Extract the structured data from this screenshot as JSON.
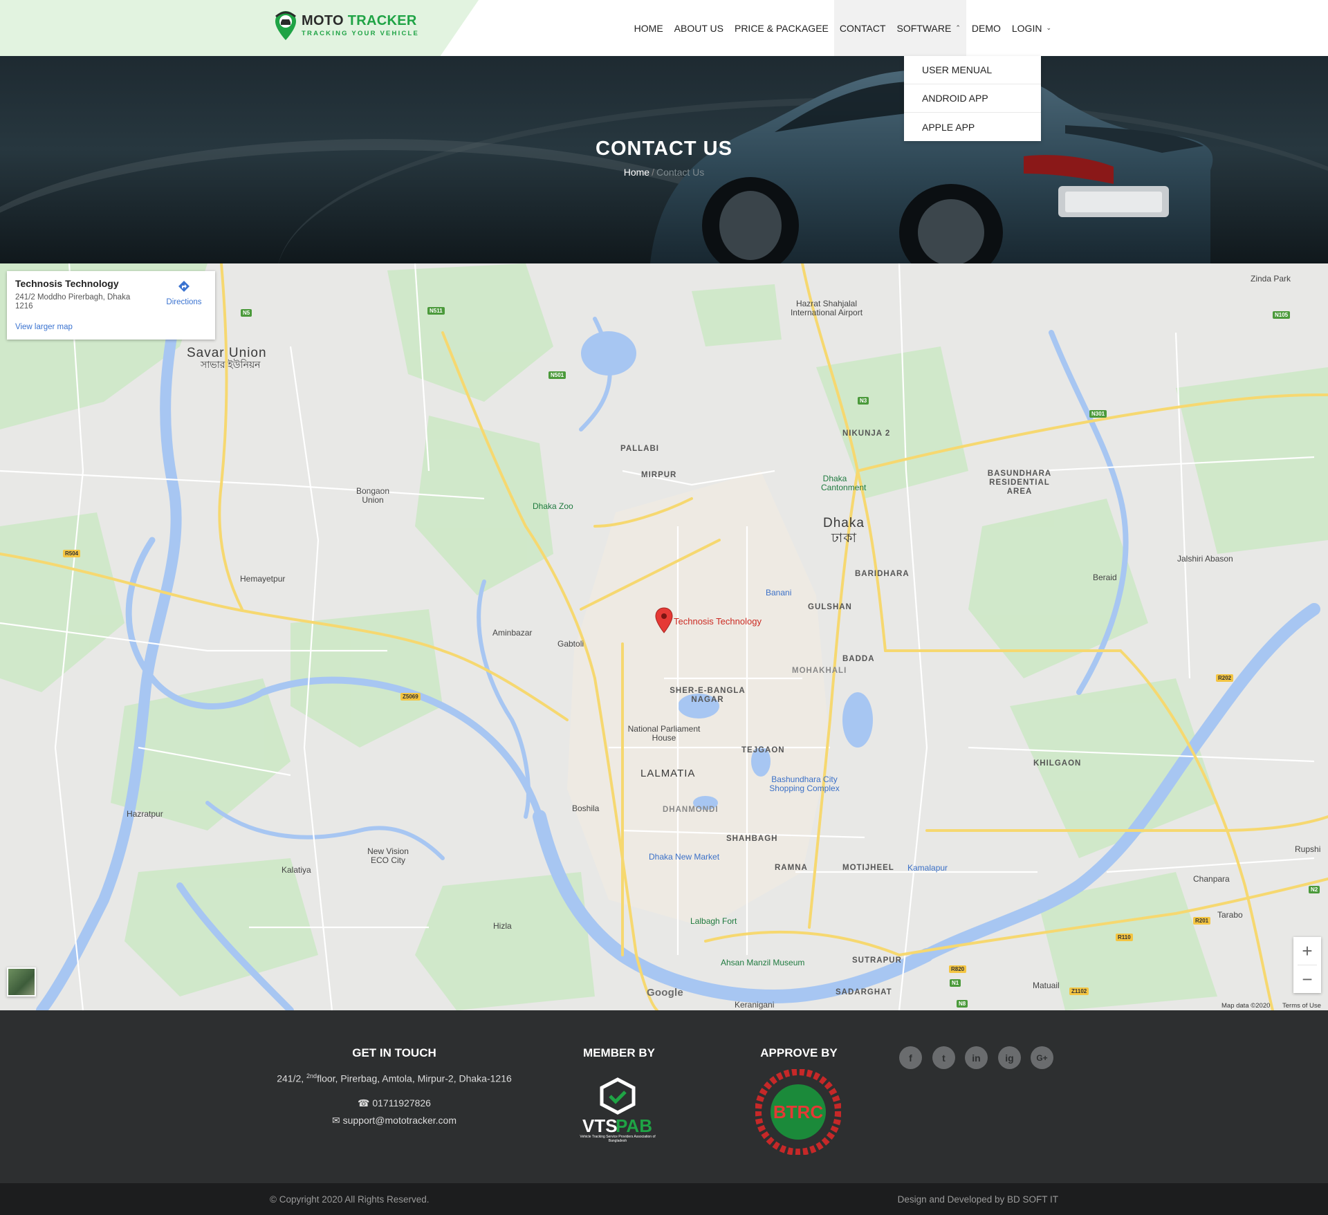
{
  "brand": {
    "name_part1": "MOTO",
    "name_part2": "TRACKER",
    "tagline": "TRACKING YOUR VEHICLE",
    "accent": "#1fa345"
  },
  "nav": {
    "items": [
      "HOME",
      "ABOUT US",
      "PRICE & PACKAGEE",
      "CONTACT",
      "SOFTWARE",
      "DEMO",
      "LOGIN"
    ],
    "software_menu": [
      "USER MENUAL",
      "ANDROID APP",
      "APPLE APP"
    ]
  },
  "hero": {
    "title": "CONTACT US",
    "crumb_home": "Home",
    "crumb_sep": "/",
    "crumb_current": "Contact Us"
  },
  "map": {
    "card_title": "Technosis Technology",
    "card_address": "241/2 Moddho Pirerbagh, Dhaka 1216",
    "directions": "Directions",
    "larger_map": "View larger map",
    "marker_label": "Technosis Technology",
    "google": "Google",
    "map_data": "Map data ©2020",
    "terms": "Terms of Use",
    "places": {
      "savar": "Savar Union",
      "savar_bn": "সাভার ইউনিয়ন",
      "hazrat": "Hazrat Shahjalal International Airport",
      "zinda": "Zinda Park",
      "pallabi": "PALLABI",
      "mirpur": "MIRPUR",
      "nikunja": "NIKUNJA 2",
      "basundhara": "BASUNDHARA RESIDENTIAL AREA",
      "bongaon": "Bongaon Union",
      "dhaka_zoo": "Dhaka Zoo",
      "dhaka_cant": "Dhaka Cantonment",
      "dhaka": "Dhaka",
      "dhaka_bn": "ঢাকা",
      "hemayetpur": "Hemayetpur",
      "baridhara": "BARIDHARA",
      "banani": "Banani",
      "jalshiri": "Jalshiri Abason",
      "beraid": "Beraid",
      "gulshan": "GULSHAN",
      "aminbazar": "Aminbazar",
      "gabtoli": "Gabtoli",
      "badda": "BADDA",
      "mohakhali": "MOHAKHALI",
      "sher": "SHER-E-BANGLA NAGAR",
      "parliament": "National Parliament House",
      "tejgaon": "TEJGAON",
      "lalmatia": "LALMATIA",
      "khilgaon": "KHILGAON",
      "bashundhara_city": "Bashundhara City Shopping Complex",
      "hazratpur": "Hazratpur",
      "boshila": "Boshila",
      "dhanmondi": "DHANMONDI",
      "new_vision": "New Vision ECO City",
      "shahbagh": "SHAHBAGH",
      "kalatiya": "Kalatiya",
      "dhaka_new_market": "Dhaka New Market",
      "ramna": "RAMNA",
      "motijheel": "MOTIJHEEL",
      "kamalapur": "Kamalapur",
      "chanpara": "Chanpara",
      "rupshi": "Rupshi",
      "tarabo": "Tarabo",
      "hizla": "Hizla",
      "lalbagh": "Lalbagh Fort",
      "ahsan": "Ahsan Manzil Museum",
      "sutrapur": "SUTRAPUR",
      "matuail": "Matuail",
      "sadarghat": "SADARGHAT",
      "keranigani": "Keranigani"
    },
    "roads": [
      "N5",
      "N511",
      "N501",
      "N3",
      "N301",
      "N105",
      "R504",
      "Z5069",
      "R202",
      "R201",
      "R110",
      "R820",
      "N1",
      "N8",
      "N2",
      "Z1102"
    ]
  },
  "footer": {
    "contact_title": "GET IN TOUCH",
    "address_pre": "241/2,",
    "address_sup": "2nd",
    "address_post": "floor, Pirerbag, Amtola, Mirpur-2, Dhaka-1216",
    "phone": "01711927826",
    "email": "support@mototracker.com",
    "member_title": "MEMBER BY",
    "member_logo_text": "VTS",
    "member_logo_text2": "PAB",
    "member_logo_sub": "Vehicle Tracking Service Providers Association of Bangladesh",
    "approve_title": "APPROVE BY",
    "approve_logo_text": "BTRC",
    "social": [
      "f",
      "t",
      "in",
      "ig",
      "G+"
    ],
    "copyright": "© Copyright 2020 All Rights Reserved.",
    "credit": "Design and Developed by BD SOFT IT"
  }
}
